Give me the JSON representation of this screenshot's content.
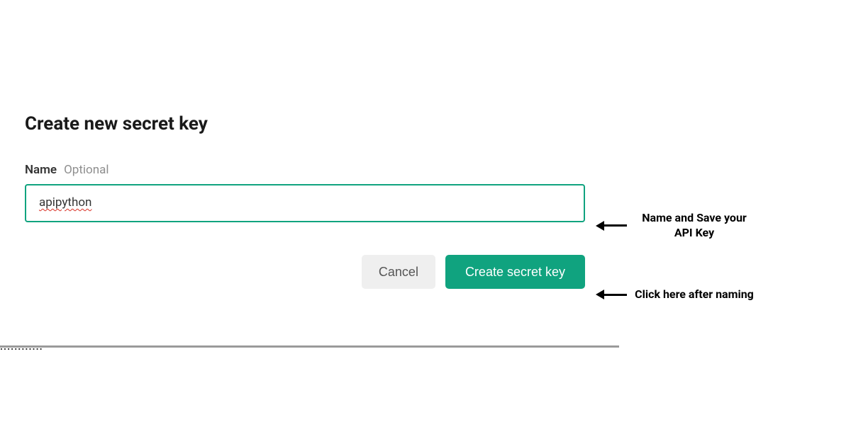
{
  "dialog": {
    "title": "Create new secret key",
    "name_label": "Name",
    "name_hint": "Optional",
    "name_value": "apipython",
    "cancel_label": "Cancel",
    "create_label": "Create secret key"
  },
  "annotations": {
    "input_note": "Name and Save your API Key",
    "button_note": "Click here after naming"
  },
  "colors": {
    "accent": "#10a37f"
  }
}
